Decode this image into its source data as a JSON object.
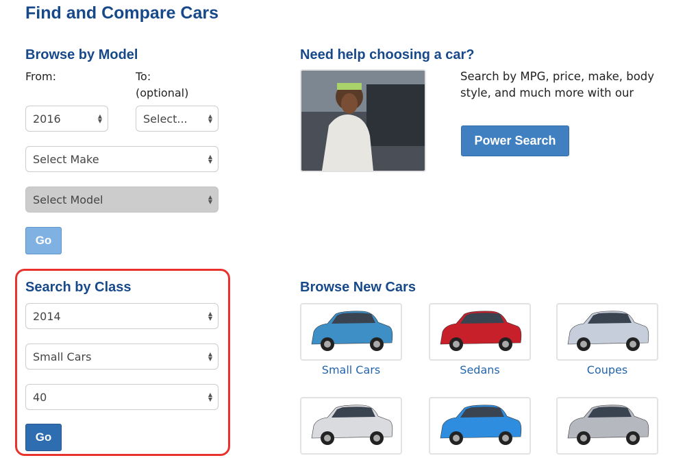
{
  "title": "Find and Compare Cars",
  "browse_model": {
    "heading": "Browse by Model",
    "from_label": "From:",
    "to_label": "To:",
    "to_optional": "(optional)",
    "from_value": "2016",
    "to_value": "Select...",
    "make_value": "Select Make",
    "model_value": "Select Model",
    "go": "Go"
  },
  "help": {
    "heading": "Need help choosing a car?",
    "text": "Search by MPG, price, make, body style, and much more with our",
    "button": "Power Search"
  },
  "search_class": {
    "heading": "Search by Class",
    "year": "2014",
    "class": "Small Cars",
    "count": "40",
    "go": "Go",
    "highlight_color": "#e8322b"
  },
  "browse_new": {
    "heading": "Browse New Cars",
    "cards": [
      {
        "label": "Small Cars",
        "color": "#3d8fc6"
      },
      {
        "label": "Sedans",
        "color": "#c8202a"
      },
      {
        "label": "Coupes",
        "color": "#c6cedb"
      },
      {
        "label": "",
        "color": "#d9dbde"
      },
      {
        "label": "",
        "color": "#2f8de0"
      },
      {
        "label": "",
        "color": "#b5b8bf"
      }
    ]
  }
}
